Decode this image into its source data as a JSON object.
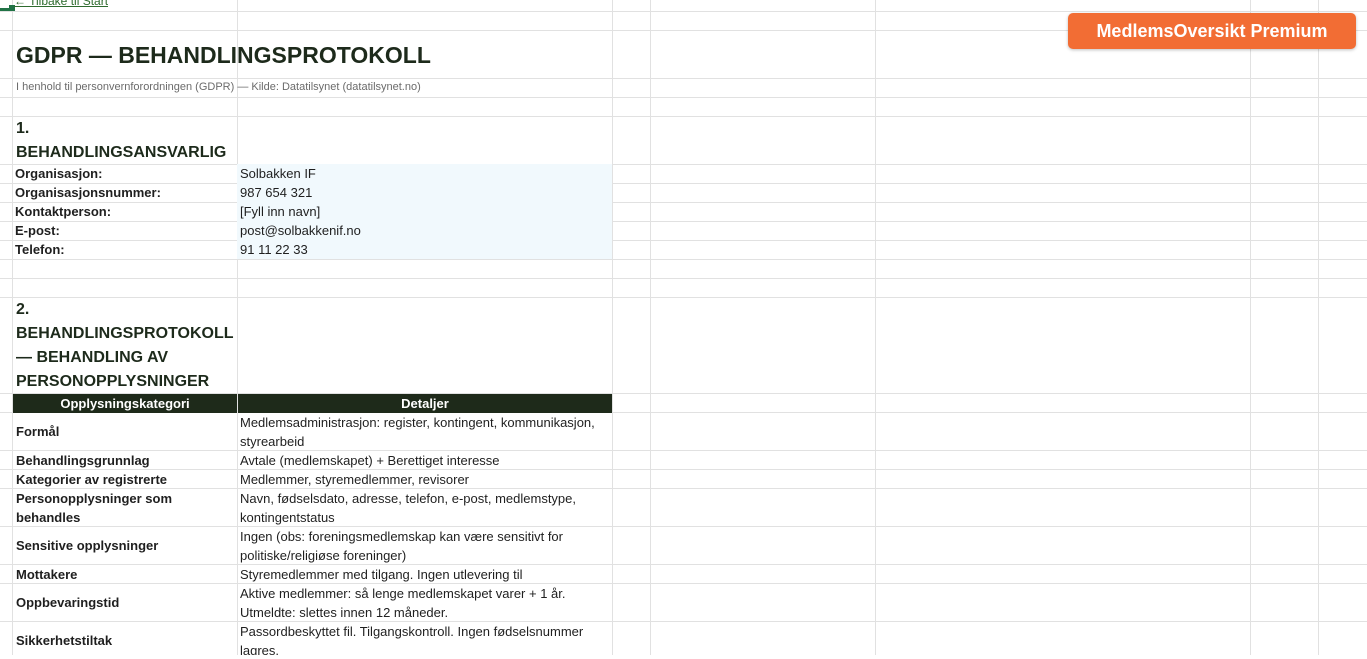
{
  "nav": {
    "back_label": "← Tilbake til Start"
  },
  "header": {
    "title": "GDPR — BEHANDLINGSPROTOKOLL",
    "subtitle": "I henhold til personvernforordningen (GDPR) — Kilde: Datatilsynet (datatilsynet.no)",
    "premium_label": "MedlemsOversikt Premium"
  },
  "section1": {
    "heading": "1. BEHANDLINGSANSVARLIG",
    "fields": [
      {
        "label": "Organisasjon:",
        "value": "Solbakken IF"
      },
      {
        "label": "Organisasjonsnummer:",
        "value": "987 654 321"
      },
      {
        "label": "Kontaktperson:",
        "value": "[Fyll inn navn]"
      },
      {
        "label": "E-post:",
        "value": "post@solbakkenif.no"
      },
      {
        "label": "Telefon:",
        "value": "91 11 22 33"
      }
    ]
  },
  "section2": {
    "heading": "2. BEHANDLINGSPROTOKOLL — BEHANDLING AV PERSONOPPLYSNINGER",
    "columns": [
      "Opplysningskategori",
      "Detaljer"
    ],
    "rows": [
      {
        "label": "Formål",
        "value": "Medlemsadministrasjon: register, kontingent, kommunikasjon, styrearbeid"
      },
      {
        "label": "Behandlingsgrunnlag",
        "value": "Avtale (medlemskapet) + Berettiget interesse"
      },
      {
        "label": "Kategorier av registrerte",
        "value": "Medlemmer, styremedlemmer, revisorer"
      },
      {
        "label": "Personopplysninger som behandles",
        "value": "Navn, fødselsdato, adresse, telefon, e-post, medlemstype, kontingentstatus"
      },
      {
        "label": "Sensitive opplysninger",
        "value": "Ingen (obs: foreningsmedlemskap kan være sensitivt for politiske/religiøse foreninger)"
      },
      {
        "label": "Mottakere",
        "value": "Styremedlemmer med tilgang. Ingen utlevering til"
      },
      {
        "label": "Oppbevaringstid",
        "value": "Aktive medlemmer: så lenge medlemskapet varer + 1 år. Utmeldte: slettes innen 12 måneder."
      },
      {
        "label": "Sikkerhetstiltak",
        "value": "Passordbeskyttet fil. Tilgangskontroll. Ingen fødselsnummer lagres."
      }
    ]
  }
}
